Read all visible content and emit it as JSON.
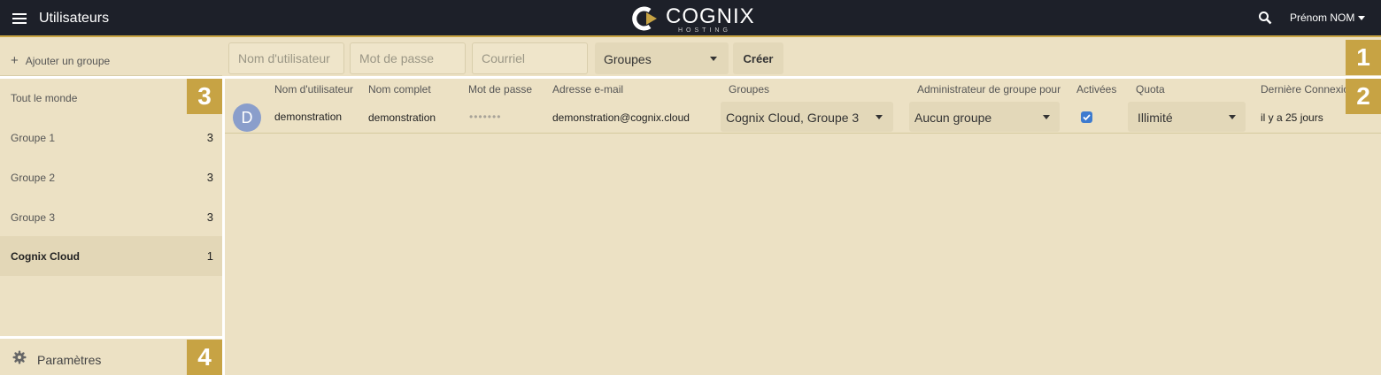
{
  "header": {
    "title": "Utilisateurs",
    "logo_text": "COGNIX",
    "logo_subtext": "HOSTING",
    "user_name": "Prénom NOM"
  },
  "sidebar": {
    "add_group_label": "Ajouter un groupe",
    "items": [
      {
        "label": "Tout le monde",
        "count": ""
      },
      {
        "label": "Groupe 1",
        "count": "3"
      },
      {
        "label": "Groupe 2",
        "count": "3"
      },
      {
        "label": "Groupe 3",
        "count": "3"
      },
      {
        "label": "Cognix Cloud",
        "count": "1"
      }
    ],
    "settings_label": "Paramètres"
  },
  "toolbar": {
    "username_placeholder": "Nom d'utilisateur",
    "password_placeholder": "Mot de passe",
    "email_placeholder": "Courriel",
    "groups_label": "Groupes",
    "create_label": "Créer"
  },
  "table": {
    "headers": {
      "username": "Nom d'utilisateur",
      "fullname": "Nom complet",
      "password": "Mot de passe",
      "email": "Adresse e-mail",
      "groups": "Groupes",
      "admin": "Administrateur de groupe pour",
      "enabled": "Activées",
      "quota": "Quota",
      "last_login": "Dernière Connexion"
    },
    "rows": [
      {
        "avatar": "D",
        "username": "demonstration",
        "fullname": "demonstration",
        "password": "•••••••",
        "email": "demonstration@cognix.cloud",
        "groups": "Cognix Cloud, Groupe 3",
        "admin": "Aucun groupe",
        "enabled": true,
        "quota": "Illimité",
        "last_login": "il y a 25 jours"
      }
    ]
  },
  "badges": {
    "b1": "1",
    "b2": "2",
    "b3": "3",
    "b4": "4"
  },
  "colors": {
    "header_bg": "#1d2029",
    "accent_gold": "#c7a344",
    "content_bg": "#ece1c4",
    "avatar": "#8a9ecb",
    "checkbox": "#3e7bcf"
  }
}
